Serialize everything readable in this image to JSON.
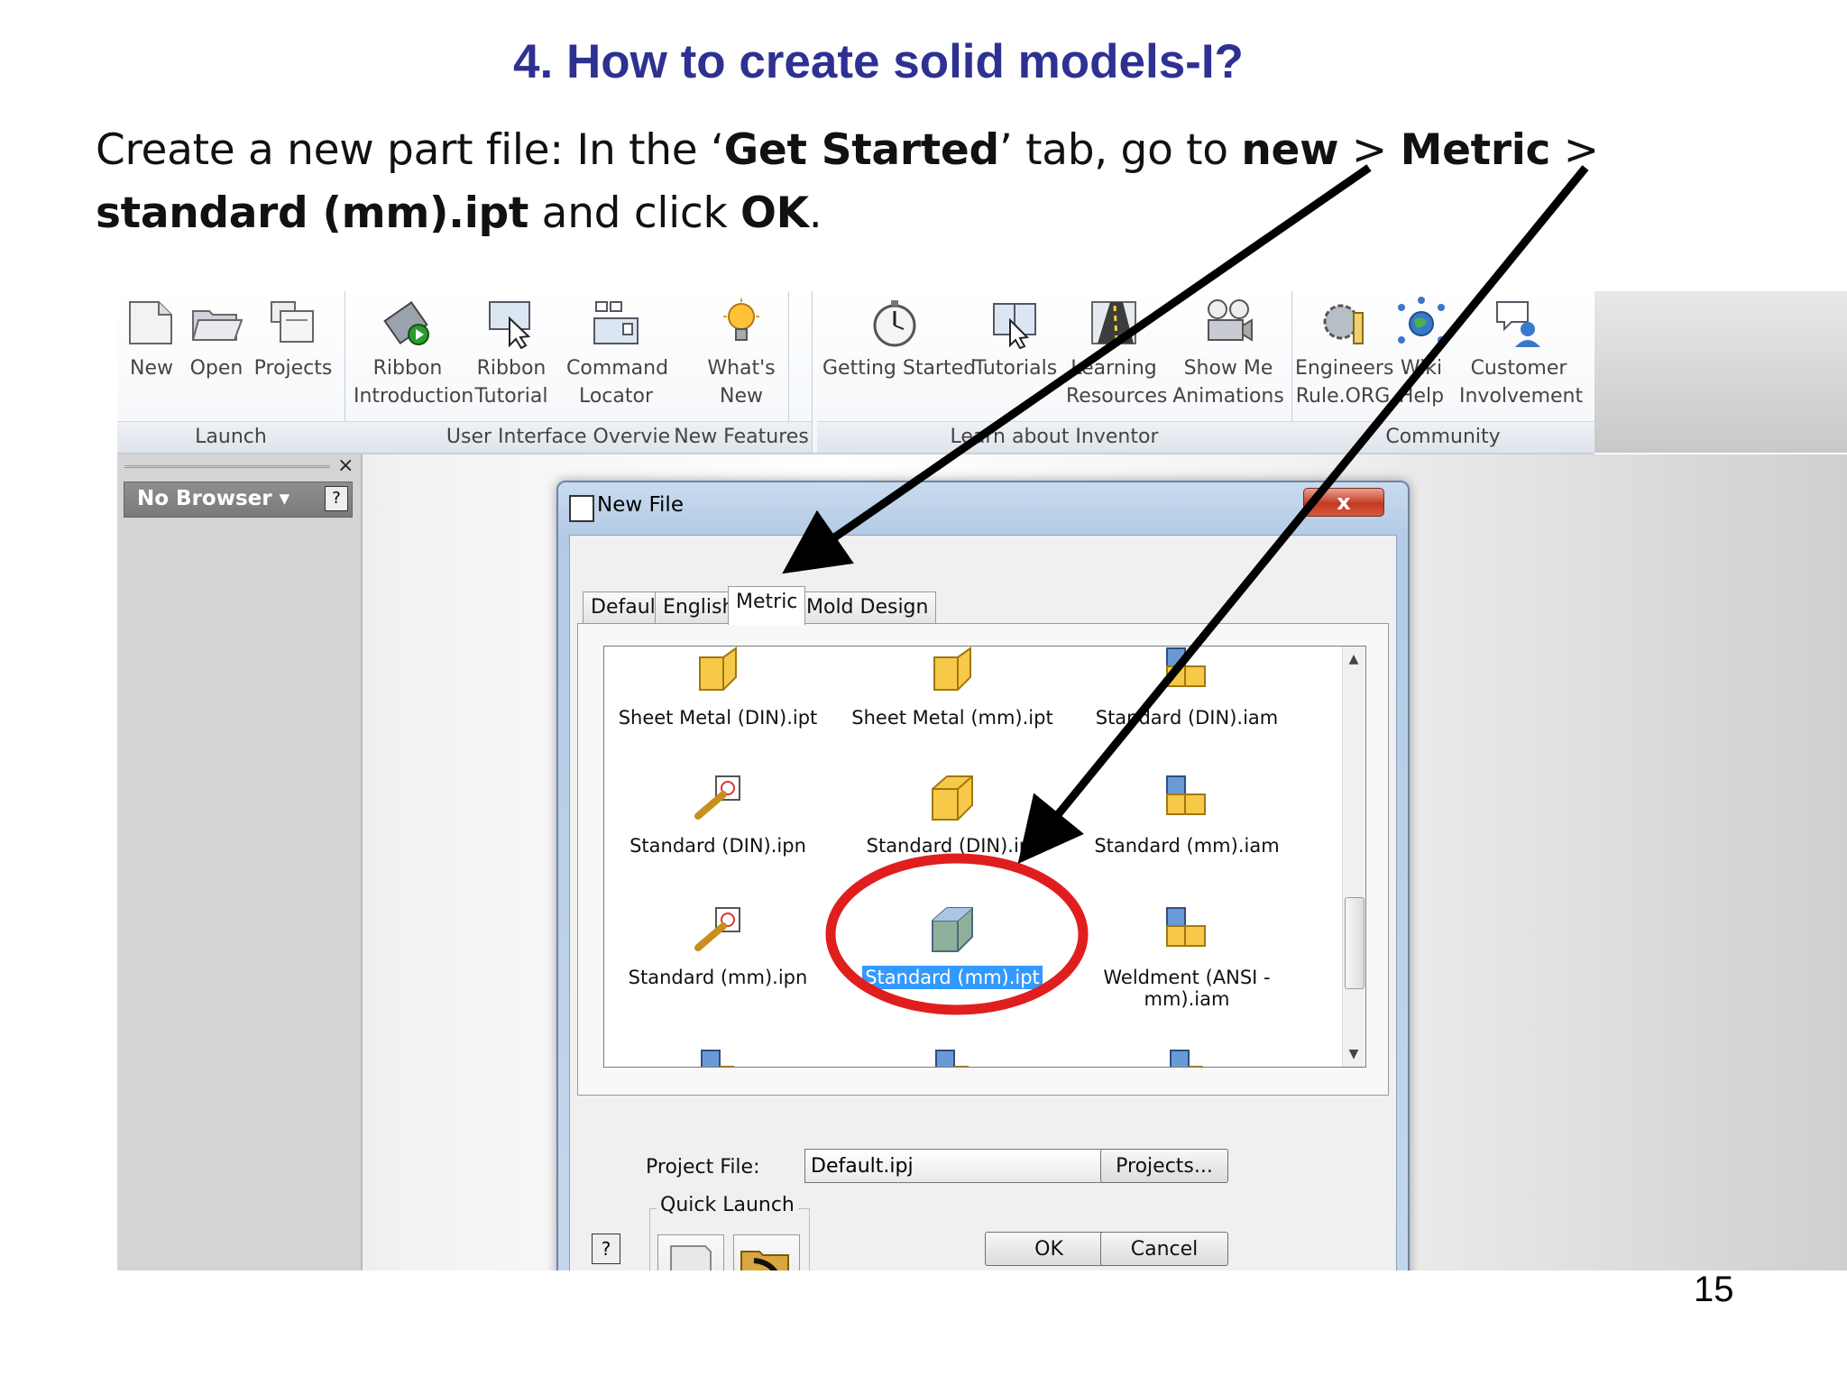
{
  "slide": {
    "title": "4. How to create solid models-I?",
    "instruction": {
      "p1": "Create a new part file: In the ‘",
      "b1": "Get Started",
      "p2": "’ tab, go to ",
      "b2": "new",
      "p3": " > ",
      "b3": "Metric",
      "p4": " > ",
      "b4": "standard (mm).ipt",
      "p5": " and click ",
      "b5": "OK",
      "p6": "."
    },
    "page_number": "15"
  },
  "ribbon": {
    "groups": {
      "launch": "Launch",
      "ui_overview": "User Interface Overview",
      "new_features": "New Features",
      "learn": "Learn about Inventor",
      "community": "Community"
    },
    "buttons": {
      "new": "New",
      "open": "Open",
      "projects": "Projects",
      "ribbon_intro": "Ribbon\nIntroduction",
      "ribbon_tutorial": "Ribbon\nTutorial",
      "command_locator": "Command\nLocator",
      "whats_new": "What's\nNew",
      "getting_started": "Getting Started",
      "tutorials": "Tutorials",
      "learning_resources": "Learning\nResources",
      "show_me": "Show Me\nAnimations",
      "engineers_rule": "Engineers\nRule.ORG",
      "wiki_help": "Wiki\nHelp",
      "customer_involvement": "Customer\nInvolvement"
    }
  },
  "browser": {
    "label": "No Browser ▾",
    "close": "×",
    "help": "?"
  },
  "dialog": {
    "title": "New File",
    "close": "x",
    "tabs": {
      "default": "Default",
      "english": "English",
      "metric": "Metric",
      "mold": "Mold Design"
    },
    "files": {
      "f1": "Sheet Metal (DIN).ipt",
      "f2": "Sheet Metal (mm).ipt",
      "f3": "Standard (DIN).iam",
      "f4": "Standard (DIN).ipn",
      "f5": "Standard (DIN).ipt",
      "f6": "Standard (mm).iam",
      "f7": "Standard (mm).ipn",
      "f8": "Standard (mm).ipt",
      "f9": "Weldment (ANSI - mm).iam"
    },
    "project_label": "Project File:",
    "project_value": "Default.ipj",
    "projects_button": "Projects...",
    "quick_launch": "Quick Launch",
    "ok": "OK",
    "cancel": "Cancel",
    "help": "?"
  },
  "colors": {
    "title": "#2E3192",
    "arrows": "#000000",
    "highlight_circle": "#E01E1E",
    "selection": "#3399FF"
  }
}
